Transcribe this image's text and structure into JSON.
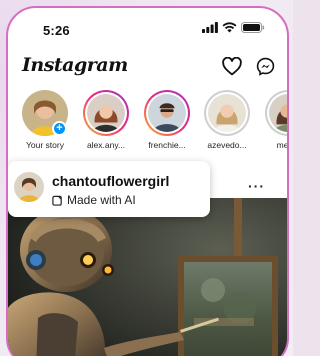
{
  "status_bar": {
    "time": "5:26"
  },
  "header": {
    "logo_text": "Instagram",
    "icons": [
      "heart-icon",
      "messenger-icon"
    ]
  },
  "stories": [
    {
      "label": "Your story",
      "ring": "none",
      "has_add_badge": true
    },
    {
      "label": "alex.any...",
      "ring": "active"
    },
    {
      "label": "frenchie...",
      "ring": "active"
    },
    {
      "label": "azevedo...",
      "ring": "seen"
    },
    {
      "label": "meish",
      "ring": "seen"
    }
  ],
  "post": {
    "username": "chantouflowergirl",
    "ai_label": "Made with AI",
    "more_label": "···"
  },
  "colors": {
    "accent": "#0095f6",
    "frame": "#d46ec2"
  }
}
